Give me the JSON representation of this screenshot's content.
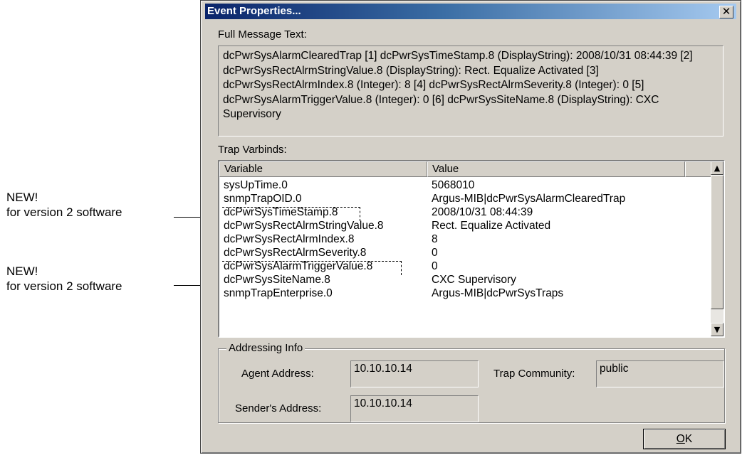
{
  "callouts": [
    {
      "line1": "NEW!",
      "line2": "for version 2 software"
    },
    {
      "line1": "NEW!",
      "line2": "for version 2 software"
    }
  ],
  "dialog": {
    "title": "Event Properties...",
    "close_glyph": "✕",
    "full_message_label": "Full Message Text:",
    "full_message_text": "dcPwrSysAlarmClearedTrap [1] dcPwrSysTimeStamp.8 (DisplayString): 2008/10/31 08:44:39 [2] dcPwrSysRectAlrmStringValue.8 (DisplayString): Rect. Equalize Activated [3] dcPwrSysRectAlrmIndex.8 (Integer): 8 [4] dcPwrSysRectAlrmSeverity.8 (Integer): 0 [5] dcPwrSysAlarmTriggerValue.8 (Integer): 0 [6] dcPwrSysSiteName.8 (DisplayString): CXC Supervisory",
    "trap_varbinds_label": "Trap Varbinds:",
    "columns": [
      "Variable",
      "Value"
    ],
    "rows": [
      {
        "variable": "sysUpTime.0",
        "value": "5068010"
      },
      {
        "variable": "snmpTrapOID.0",
        "value": "Argus-MIB|dcPwrSysAlarmClearedTrap"
      },
      {
        "variable": "dcPwrSysTimeStamp.8",
        "value": "2008/10/31 08:44:39"
      },
      {
        "variable": "dcPwrSysRectAlrmStringValue.8",
        "value": "Rect. Equalize Activated"
      },
      {
        "variable": "dcPwrSysRectAlrmIndex.8",
        "value": "8"
      },
      {
        "variable": "dcPwrSysRectAlrmSeverity.8",
        "value": "0"
      },
      {
        "variable": "dcPwrSysAlarmTriggerValue.8",
        "value": "0"
      },
      {
        "variable": "dcPwrSysSiteName.8",
        "value": "CXC Supervisory"
      },
      {
        "variable": "snmpTrapEnterprise.0",
        "value": "Argus-MIB|dcPwrSysTraps"
      }
    ],
    "scroll_up": "▲",
    "scroll_down": "▼",
    "addressing": {
      "group_label": "Addressing Info",
      "agent_label": "Agent Address:",
      "agent_value": "10.10.10.14",
      "community_label": "Trap Community:",
      "community_value": "public",
      "sender_label": "Sender's Address:",
      "sender_value": "10.10.10.14"
    },
    "ok_prefix": "O",
    "ok_rest": "K"
  }
}
